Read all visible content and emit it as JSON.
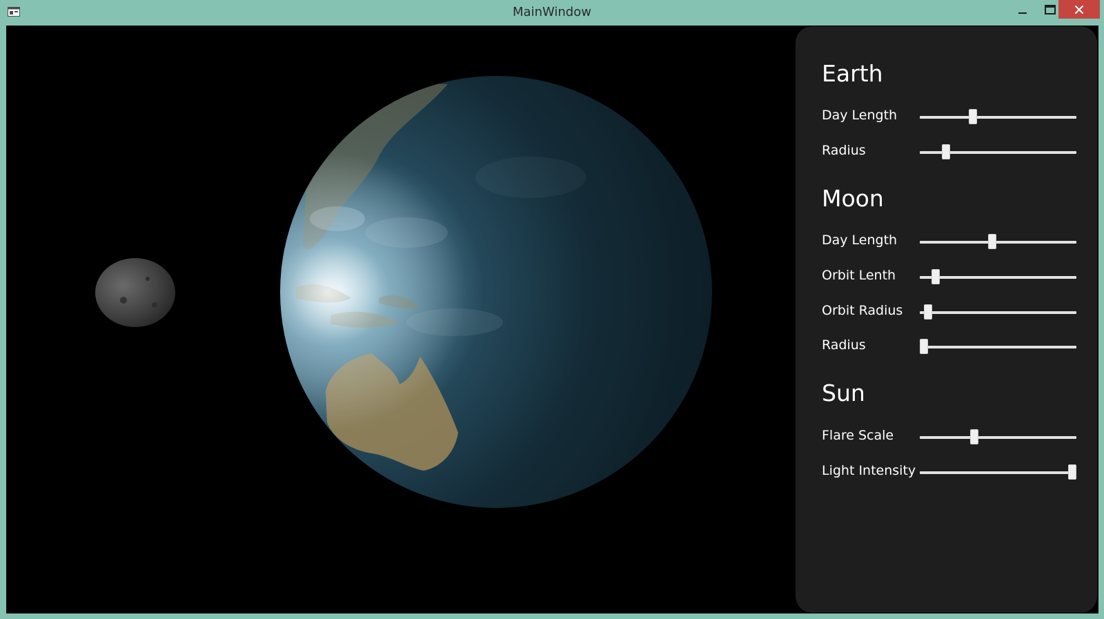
{
  "window": {
    "title": "MainWindow",
    "icons": {
      "app": "window-app-icon",
      "minimize": "minimize-icon",
      "maximize": "maximize-icon",
      "close": "close-icon"
    },
    "colors": {
      "frame": "#86c2b2",
      "close_button": "#c7453f"
    }
  },
  "scene": {
    "objects": [
      "earth",
      "moon"
    ],
    "colors": {
      "background": "#000000",
      "ocean": "#2e5a6e",
      "land": "#9a8a5e",
      "moon": "#555555"
    }
  },
  "panel": {
    "background": "#1e1e1e",
    "sections": [
      {
        "title": "Earth",
        "controls": [
          {
            "label": "Day Length",
            "value": 0.33
          },
          {
            "label": "Radius",
            "value": 0.15
          }
        ]
      },
      {
        "title": "Moon",
        "controls": [
          {
            "label": "Day Length",
            "value": 0.46
          },
          {
            "label": "Orbit Lenth",
            "value": 0.08
          },
          {
            "label": "Orbit Radius",
            "value": 0.03
          },
          {
            "label": "Radius",
            "value": 0.0
          }
        ]
      },
      {
        "title": "Sun",
        "controls": [
          {
            "label": "Flare Scale",
            "value": 0.34
          },
          {
            "label": "Light Intensity",
            "value": 1.0
          }
        ]
      }
    ]
  }
}
